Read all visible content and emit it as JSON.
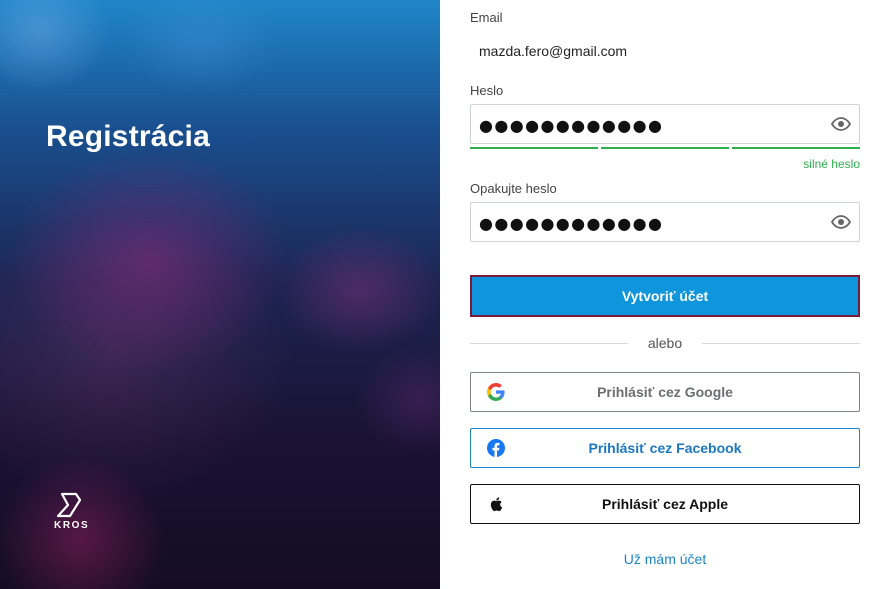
{
  "hero": {
    "title": "Registrácia",
    "logo_text": "KROS"
  },
  "form": {
    "email_label": "Email",
    "email_value": "mazda.fero@gmail.com",
    "password_label": "Heslo",
    "password_mask": "●●●●●●●●●●●●",
    "strength_text": "silné heslo",
    "strength_level": 1.0,
    "repeat_label": "Opakujte heslo",
    "repeat_mask": "●●●●●●●●●●●●",
    "submit_label": "Vytvoriť účet",
    "divider_text": "alebo",
    "google_label": "Prihlásiť cez Google",
    "facebook_label": "Prihlásiť cez Facebook",
    "apple_label": "Prihlásiť cez Apple",
    "login_link": "Už mám účet"
  },
  "icons": {
    "eye": "eye-icon",
    "google": "google-icon",
    "facebook": "facebook-icon",
    "apple": "apple-icon",
    "logo": "kros-logo-icon"
  },
  "colors": {
    "primary": "#0f95dc",
    "primary_border": "#7a1a3a",
    "success": "#2eae4e",
    "link": "#1a86c8",
    "facebook": "#1a78c2"
  }
}
